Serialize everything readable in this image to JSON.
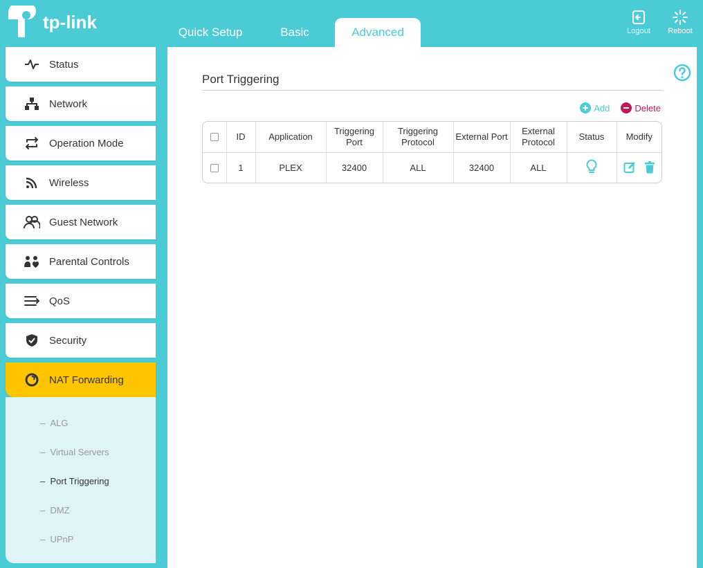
{
  "brand": {
    "name": "tp-link"
  },
  "header": {
    "tabs": [
      {
        "label": "Quick Setup"
      },
      {
        "label": "Basic"
      },
      {
        "label": "Advanced"
      }
    ],
    "actions": {
      "logout": "Logout",
      "reboot": "Reboot"
    }
  },
  "sidebar": {
    "items": [
      {
        "label": "Status",
        "icon": "pulse-icon"
      },
      {
        "label": "Network",
        "icon": "network-icon"
      },
      {
        "label": "Operation Mode",
        "icon": "swap-icon"
      },
      {
        "label": "Wireless",
        "icon": "wifi-icon"
      },
      {
        "label": "Guest Network",
        "icon": "guests-icon"
      },
      {
        "label": "Parental Controls",
        "icon": "family-icon"
      },
      {
        "label": "QoS",
        "icon": "qos-icon"
      },
      {
        "label": "Security",
        "icon": "shield-icon"
      },
      {
        "label": "NAT Forwarding",
        "icon": "nat-icon"
      }
    ],
    "submenu": [
      {
        "label": "ALG"
      },
      {
        "label": "Virtual Servers"
      },
      {
        "label": "Port Triggering"
      },
      {
        "label": "DMZ"
      },
      {
        "label": "UPnP"
      }
    ]
  },
  "main": {
    "title": "Port Triggering",
    "add_label": "Add",
    "delete_label": "Delete",
    "table": {
      "headers": {
        "id": "ID",
        "application": "Application",
        "triggering_port": "Triggering Port",
        "triggering_protocol": "Triggering Protocol",
        "external_port": "External Port",
        "external_protocol": "External Protocol",
        "status": "Status",
        "modify": "Modify"
      },
      "rows": [
        {
          "id": "1",
          "application": "PLEX",
          "triggering_port": "32400",
          "triggering_protocol": "ALL",
          "external_port": "32400",
          "external_protocol": "ALL",
          "status": "enabled"
        }
      ]
    }
  },
  "colors": {
    "accent": "#4acbd6",
    "active": "#ffc600",
    "danger": "#c2185b"
  }
}
